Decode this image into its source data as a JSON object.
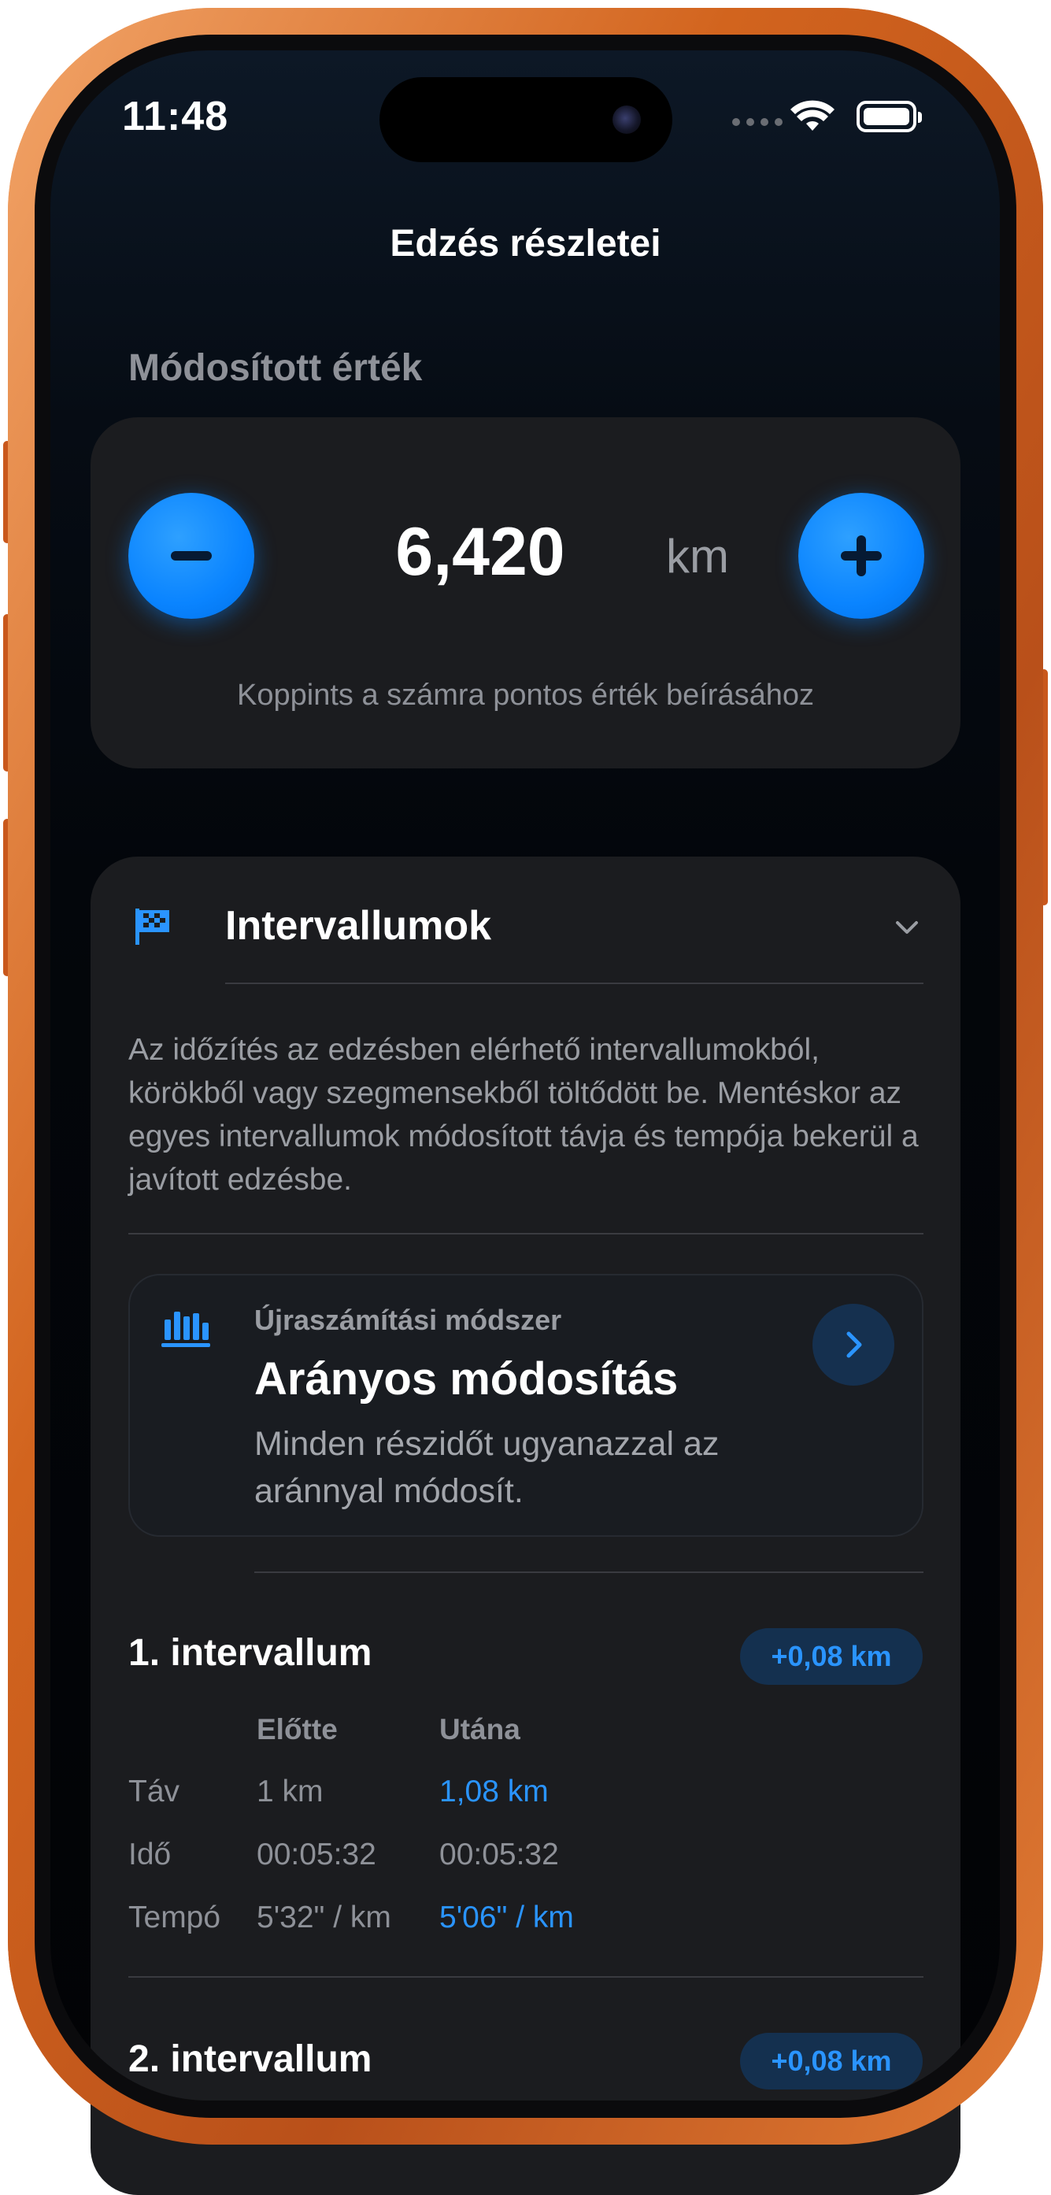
{
  "status_bar": {
    "time": "11:48"
  },
  "nav": {
    "title": "Edzés részletei"
  },
  "value_section": {
    "label": "Módosított érték",
    "value": "6,420",
    "unit": "km",
    "hint": "Koppints a számra pontos érték beírásához"
  },
  "intervals": {
    "title": "Intervallumok",
    "description": "Az időzítés az edzésben elérhető intervallumokból, körökből vagy szegmensekből töltődött be. Mentéskor az egyes intervallumok módosított távja és tempója bekerül a javított edzésbe.",
    "method": {
      "label": "Újraszámítási módszer",
      "name": "Arányos módosítás",
      "description": "Minden részidőt ugyanazzal az aránnyal módosít."
    },
    "columns": {
      "before": "Előtte",
      "after": "Utána"
    },
    "rows": {
      "distance": "Táv",
      "time": "Idő",
      "pace": "Tempó"
    },
    "items": [
      {
        "name": "1. intervallum",
        "delta": "+0,08 km",
        "distance_before": "1 km",
        "distance_after": "1,08 km",
        "time_before": "00:05:32",
        "time_after": "00:05:32",
        "pace_before": "5'32\" / km",
        "pace_after": "5'06\" / km"
      },
      {
        "name": "2. intervallum",
        "delta": "+0,08 km"
      }
    ]
  },
  "colors": {
    "accent": "#0a84ff",
    "frame": "#d2641e",
    "card": "#1b1c1f"
  }
}
